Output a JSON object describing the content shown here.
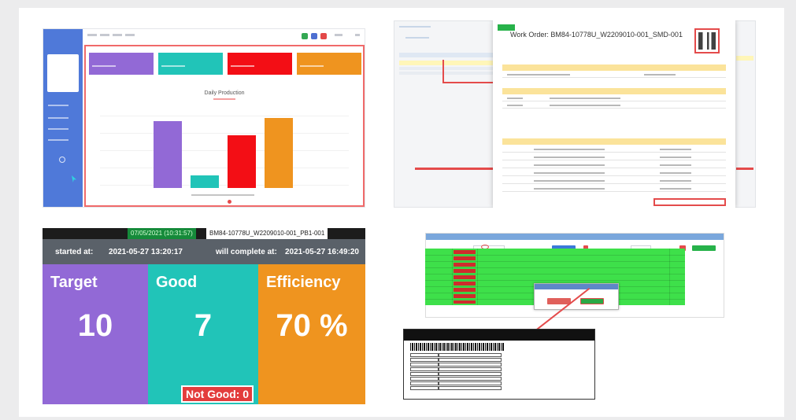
{
  "collage": {
    "dashboard": {
      "chart_data": {
        "type": "bar",
        "title": "Daily Production",
        "categories": [
          "",
          "",
          "",
          ""
        ],
        "values": [
          85,
          16,
          67,
          89
        ],
        "colors": [
          "#9269d6",
          "#21c4b8",
          "#f30e15",
          "#ef941f"
        ],
        "ylim": [
          0,
          100
        ]
      },
      "kpi_colors": [
        "#9269d6",
        "#21c4b8",
        "#f30e15",
        "#ef941f"
      ]
    },
    "work_order": {
      "title": "Work Order: BM84-10778U_W2209010-001_SMD-001",
      "accent": "#e44b4b",
      "header_color": "#fbe39a"
    },
    "board": {
      "date_label": "07/05/2021 (10:31:57)",
      "work_order": "BM84-10778U_W2209010-001_PB1-001",
      "started_label": "started at:",
      "started_value": "2021-05-27 13:20:17",
      "complete_label": "will complete at:",
      "complete_value": "2021-05-27 16:49:20",
      "tiles": [
        {
          "label": "Target",
          "value": "10",
          "color": "#9269d6"
        },
        {
          "label": "Good",
          "value": "7",
          "color": "#21c4b8"
        },
        {
          "label": "Efficiency",
          "value": "70 %",
          "color": "#ef941f"
        }
      ],
      "not_good": "Not Good: 0"
    },
    "label_print": {
      "grid_color": "#3ee04a",
      "cell_color": "#cf2c2c",
      "accent": "#e44b4b"
    }
  }
}
